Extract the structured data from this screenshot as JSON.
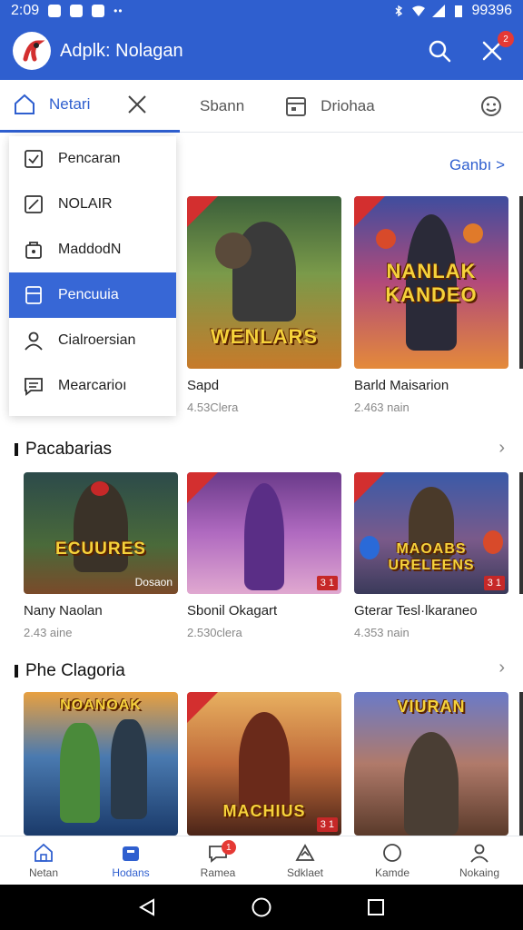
{
  "status": {
    "time": "2:09",
    "right_text": "99396"
  },
  "app": {
    "title": "Adplk: Nolagan",
    "notification_badge": "2"
  },
  "tabs": [
    {
      "label": "Netari",
      "icon": "home-icon",
      "active": true
    },
    {
      "label": "",
      "icon": "close-icon",
      "active": false
    },
    {
      "label": "Sbann",
      "icon": "",
      "active": false
    },
    {
      "label": "Driohaa",
      "icon": "calendar-icon",
      "active": false
    }
  ],
  "dropdown": {
    "items": [
      {
        "label": "Pencaran",
        "icon": "checkbox-icon",
        "selected": false
      },
      {
        "label": "NOLAIR",
        "icon": "edit-icon",
        "selected": false
      },
      {
        "label": "MaddodN",
        "icon": "bag-icon",
        "selected": false
      },
      {
        "label": "Pencuuia",
        "icon": "card-icon",
        "selected": true
      },
      {
        "label": "Cialroersian",
        "icon": "person-icon",
        "selected": false
      },
      {
        "label": "Mearcarioı",
        "icon": "message-icon",
        "selected": false
      }
    ]
  },
  "featured": {
    "see_all": "Ganbı >",
    "cards": [
      {
        "title": "Sapd",
        "sub": "4.53Clera",
        "art": "WENLARS"
      },
      {
        "title": "Barld Maisarion",
        "sub": "2.463 nain",
        "art": "NANLAK KANDEO"
      }
    ]
  },
  "section1": {
    "title": "Pacabarias",
    "cards": [
      {
        "title": "Nany Naolan",
        "sub": "2.43 aine",
        "art": "ECUURES",
        "tag": "Dosaon"
      },
      {
        "title": "Sbonil Okagart",
        "sub": "2.530clera",
        "art": "",
        "tag": "3 1"
      },
      {
        "title": "Gterar Tesl·lkaraneo",
        "sub": "4.353 nain",
        "art": "MAOABS URELEENS",
        "tag": "3 1"
      }
    ]
  },
  "section2": {
    "title": "Phe Clagoria",
    "cards": [
      {
        "art": "NOANOAK"
      },
      {
        "art": "MACHIUS",
        "tag": "3 1"
      },
      {
        "art": "VIURAN"
      }
    ]
  },
  "bottom_nav": [
    {
      "label": "Netan",
      "icon": "home-icon",
      "active": false
    },
    {
      "label": "Hodans",
      "icon": "bag-icon",
      "active": true
    },
    {
      "label": "Ramea",
      "icon": "chat-icon",
      "active": false,
      "badge": "1"
    },
    {
      "label": "Sdklaet",
      "icon": "triangle-icon",
      "active": false
    },
    {
      "label": "Kamde",
      "icon": "circle-icon",
      "active": false
    },
    {
      "label": "Nokaing",
      "icon": "person-icon",
      "active": false
    }
  ]
}
